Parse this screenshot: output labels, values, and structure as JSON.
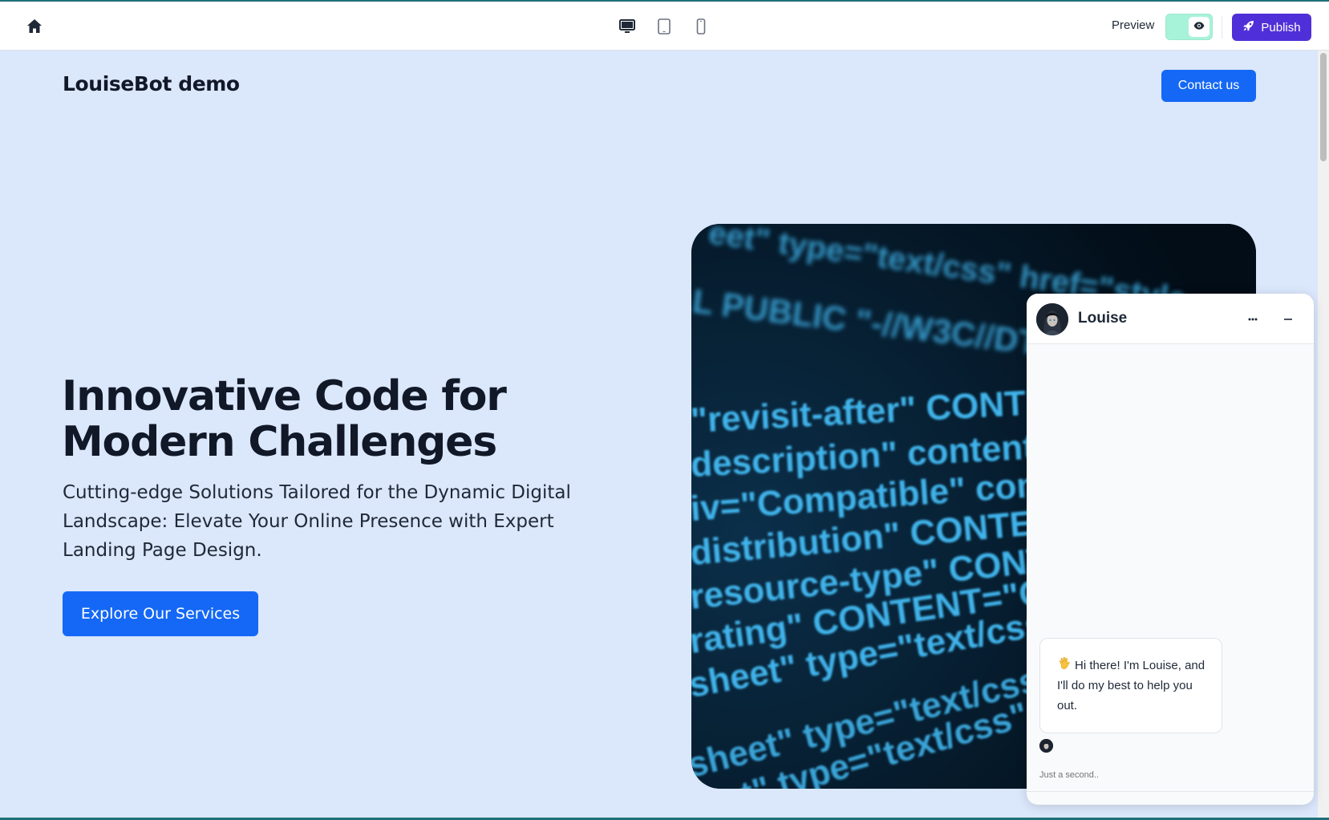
{
  "editor": {
    "preview_label": "Preview",
    "publish_label": "Publish",
    "devices": [
      "desktop-icon",
      "tablet-icon",
      "mobile-icon"
    ],
    "preview_enabled": true
  },
  "site": {
    "brand": "LouiseBot demo",
    "contact_label": "Contact us",
    "hero": {
      "title": "Innovative Code for Modern Challenges",
      "subtitle": "Cutting-edge Solutions Tailored for the Dynamic Digital Landscape: Elevate Your Online Presence with Expert Landing Page Design.",
      "cta_label": "Explore Our Services"
    }
  },
  "chat": {
    "bot_name": "Louise",
    "greeting": "Hi there! I'm Louise, and I'll do my best to help you out.",
    "input_placeholder": "Just a second.."
  },
  "colors": {
    "page_bg": "#dbe7fb",
    "primary_blue": "#1468f5",
    "publish_purple": "#4f30d8",
    "toggle_mint": "#a7f3d9",
    "code_bg": "#031726",
    "code_text": "#3fb3ea"
  }
}
